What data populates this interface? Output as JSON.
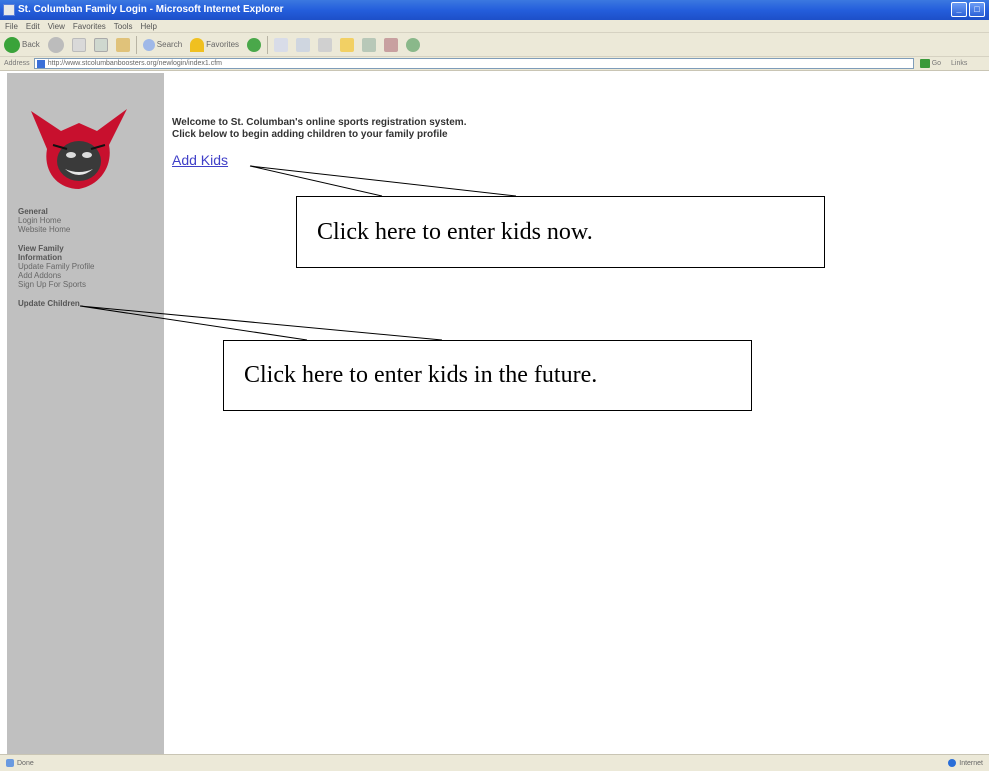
{
  "window": {
    "title": "St. Columban Family Login - Microsoft Internet Explorer"
  },
  "menubar": {
    "items": [
      "File",
      "Edit",
      "View",
      "Favorites",
      "Tools",
      "Help"
    ]
  },
  "toolbar": {
    "back_label": "Back",
    "search_label": "Search",
    "favorites_label": "Favorites"
  },
  "addressbar": {
    "label": "Address",
    "url": "http://www.stcolumbanboosters.org/newlogin/index1.cfm",
    "go_label": "Go",
    "links_label": "Links"
  },
  "sidebar": {
    "general_heading": "General",
    "items_general": [
      "Login Home",
      "Website Home"
    ],
    "family_heading": "View Family Information",
    "items_family": [
      "Update Family Profile",
      "Add Addons",
      "Sign Up For Sports"
    ],
    "children_heading": "Update Children"
  },
  "main": {
    "welcome_line1": "Welcome to St. Columban's online sports registration system.",
    "welcome_line2": "Click below to begin adding children to your family profile",
    "add_kids_link": "Add Kids"
  },
  "callouts": {
    "now": "Click here to enter kids now.",
    "future": "Click here to enter kids in the future."
  },
  "statusbar": {
    "left": "Done",
    "zone": "Internet"
  }
}
